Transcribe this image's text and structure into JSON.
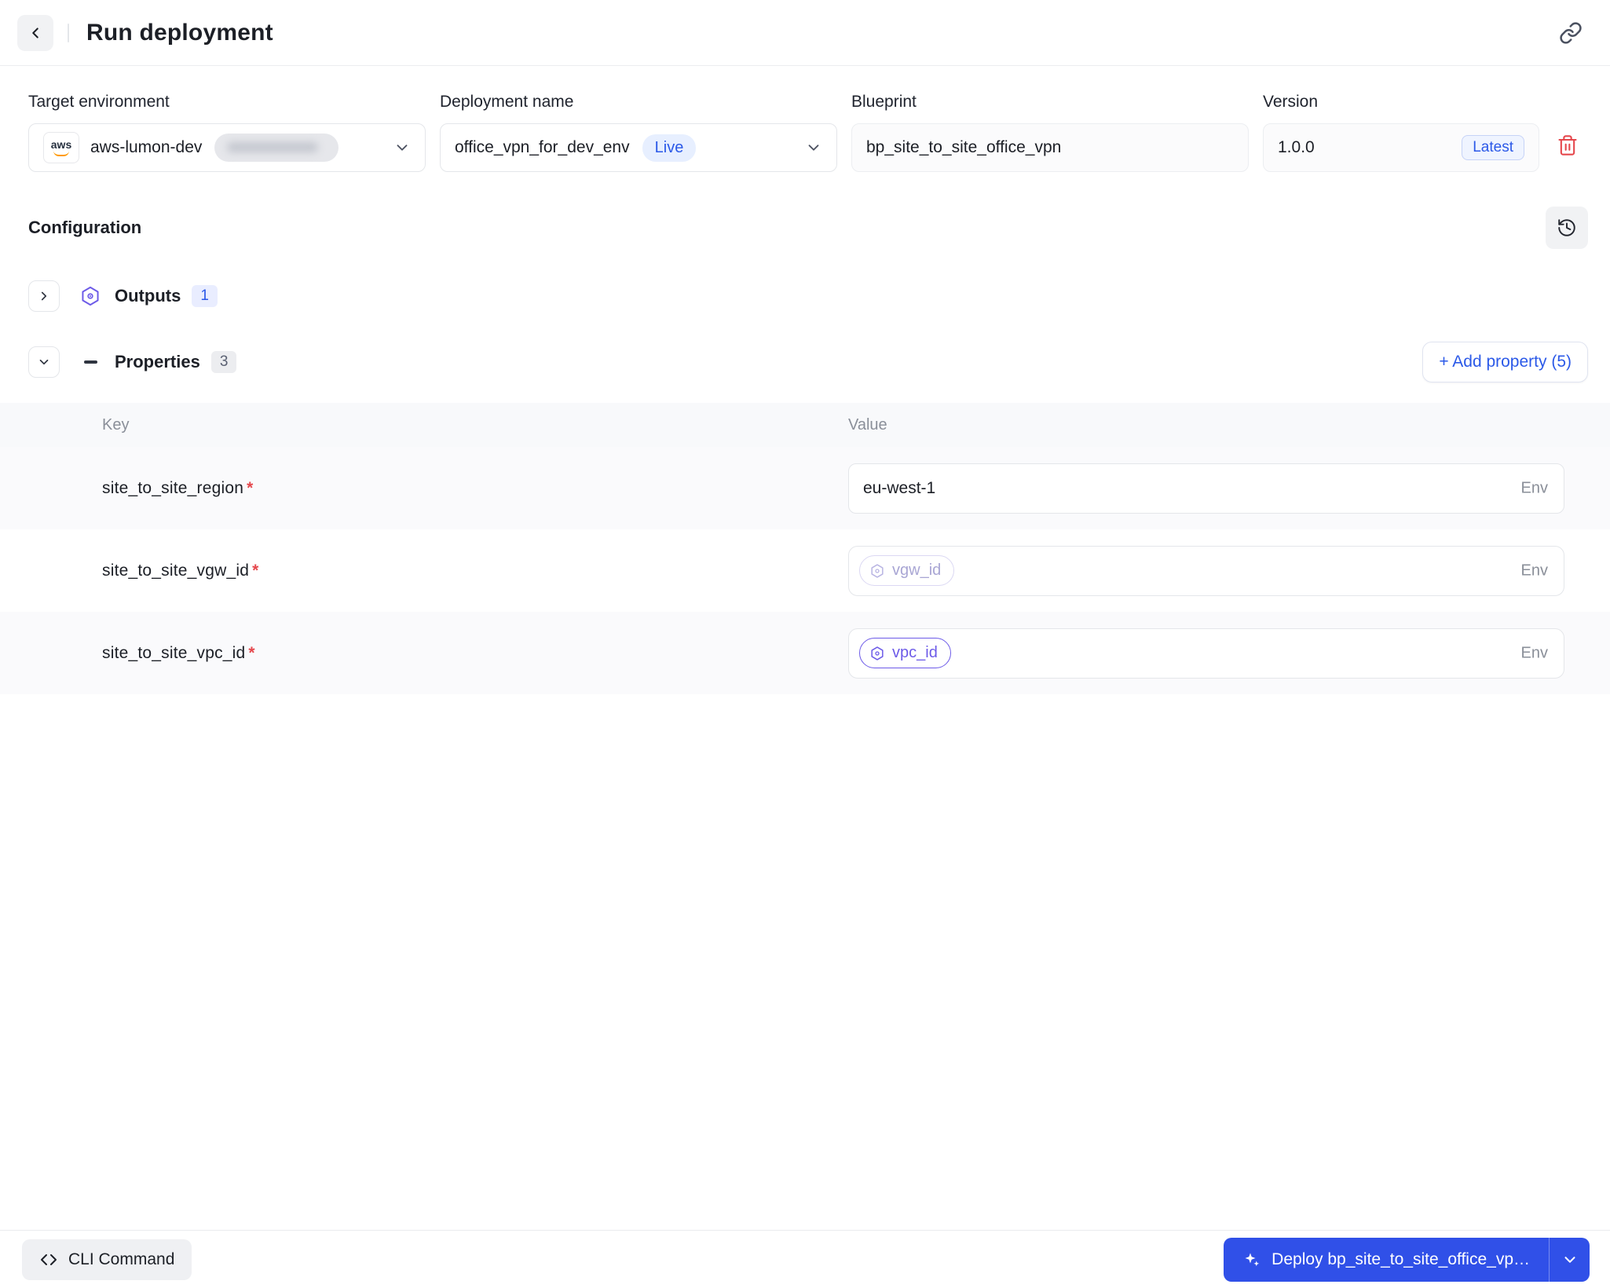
{
  "header": {
    "title": "Run deployment"
  },
  "form": {
    "target_environment": {
      "label": "Target environment",
      "value": "aws-lumon-dev"
    },
    "deployment_name": {
      "label": "Deployment name",
      "value": "office_vpn_for_dev_env",
      "status_badge": "Live"
    },
    "blueprint": {
      "label": "Blueprint",
      "value": "bp_site_to_site_office_vpn"
    },
    "version": {
      "label": "Version",
      "value": "1.0.0",
      "badge": "Latest"
    }
  },
  "configuration": {
    "title": "Configuration",
    "outputs": {
      "label": "Outputs",
      "count": "1"
    },
    "properties": {
      "label": "Properties",
      "count": "3",
      "add_button_label": "+ Add property (5)"
    }
  },
  "table": {
    "key_header": "Key",
    "value_header": "Value",
    "rows": [
      {
        "key": "site_to_site_region",
        "required": "*",
        "value": "eu-west-1",
        "suffix": "Env"
      },
      {
        "key": "site_to_site_vgw_id",
        "required": "*",
        "chip": "vgw_id",
        "suffix": "Env"
      },
      {
        "key": "site_to_site_vpc_id",
        "required": "*",
        "chip": "vpc_id",
        "suffix": "Env"
      }
    ]
  },
  "footer": {
    "cli_command_label": "CLI Command",
    "deploy_label": "Deploy bp_site_to_site_office_vp…"
  },
  "colors": {
    "accent_blue": "#2b59e8",
    "button_blue": "#3050e8",
    "purple": "#6d5be8",
    "danger_red": "#e5484d",
    "live_badge_bg": "#e7efff"
  }
}
